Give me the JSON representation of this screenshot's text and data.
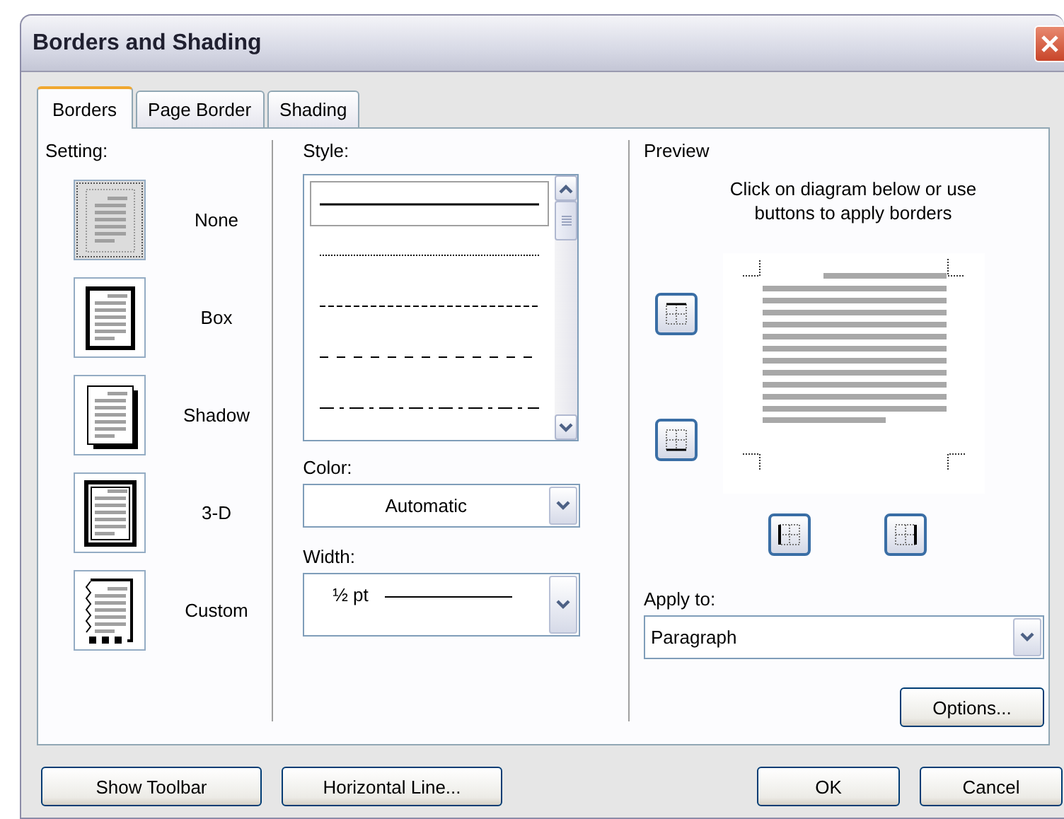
{
  "window": {
    "title": "Borders and Shading"
  },
  "tabs": [
    {
      "label": "Borders",
      "selected": true
    },
    {
      "label": "Page Border",
      "selected": false
    },
    {
      "label": "Shading",
      "selected": false
    }
  ],
  "setting": {
    "label": "Setting:",
    "items": [
      {
        "kind": "none",
        "label": "None",
        "selected": true
      },
      {
        "kind": "box",
        "label": "Box",
        "selected": false
      },
      {
        "kind": "shadow",
        "label": "Shadow",
        "selected": false
      },
      {
        "kind": "threed",
        "label": "3-D",
        "selected": false
      },
      {
        "kind": "custom",
        "label": "Custom",
        "selected": false
      }
    ]
  },
  "style": {
    "label": "Style:",
    "items": [
      {
        "kind": "solid",
        "selected": true
      },
      {
        "kind": "dotted",
        "selected": false
      },
      {
        "kind": "dashed",
        "selected": false
      },
      {
        "kind": "dashes",
        "selected": false
      },
      {
        "kind": "dashdot",
        "selected": false
      }
    ]
  },
  "color": {
    "label": "Color:",
    "value": "Automatic"
  },
  "width": {
    "label": "Width:",
    "value": "½ pt"
  },
  "preview": {
    "label": "Preview",
    "hint": "Click on diagram below or use buttons to apply borders",
    "side_buttons": [
      {
        "kind": "top"
      },
      {
        "kind": "bottom"
      }
    ],
    "bottom_buttons": [
      {
        "kind": "left"
      },
      {
        "kind": "right"
      }
    ]
  },
  "apply_to": {
    "label": "Apply to:",
    "value": "Paragraph"
  },
  "options_button": "Options...",
  "footer_left": [
    "Show Toolbar",
    "Horizontal Line..."
  ],
  "footer_right": [
    "OK",
    "Cancel"
  ]
}
